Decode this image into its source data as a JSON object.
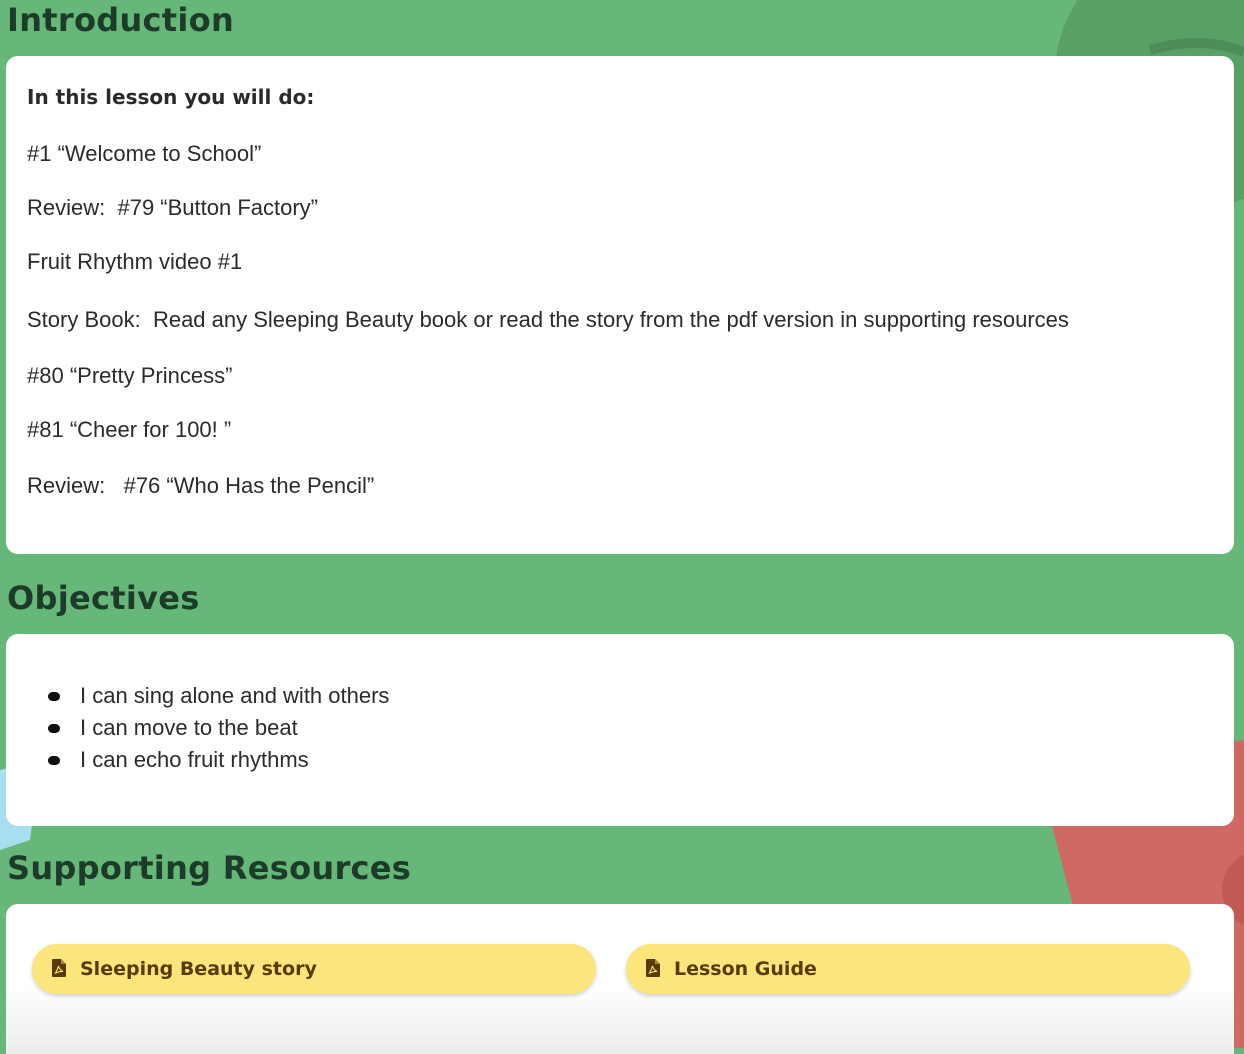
{
  "colors": {
    "background": "#68b77a",
    "title": "#1d3b29",
    "card": "#ffffff",
    "button": "#fce57a",
    "button_text": "#5a3a08",
    "decor_red": "#d46a66",
    "decor_dark_green": "#55995f",
    "decor_light_blue": "#a7dff0"
  },
  "introduction": {
    "title": "Introduction",
    "heading": "In this lesson you will do:",
    "lines": [
      "#1 “Welcome to School”",
      "Review:  #79 “Button Factory”",
      "Fruit Rhythm video #1",
      "Story Book:  Read any Sleeping Beauty book or read the story from the pdf version in supporting resources",
      "#80 “Pretty Princess”",
      "#81 “Cheer for 100! ”",
      "Review:   #76 “Who Has the Pencil”"
    ]
  },
  "objectives": {
    "title": "Objectives",
    "items": [
      "I can sing alone and with others",
      "I can move to the beat",
      "I can echo fruit rhythms"
    ]
  },
  "resources": {
    "title": "Supporting Resources",
    "items": [
      {
        "label": "Sleeping Beauty story",
        "icon": "pdf-icon"
      },
      {
        "label": "Lesson Guide",
        "icon": "pdf-icon"
      }
    ]
  }
}
